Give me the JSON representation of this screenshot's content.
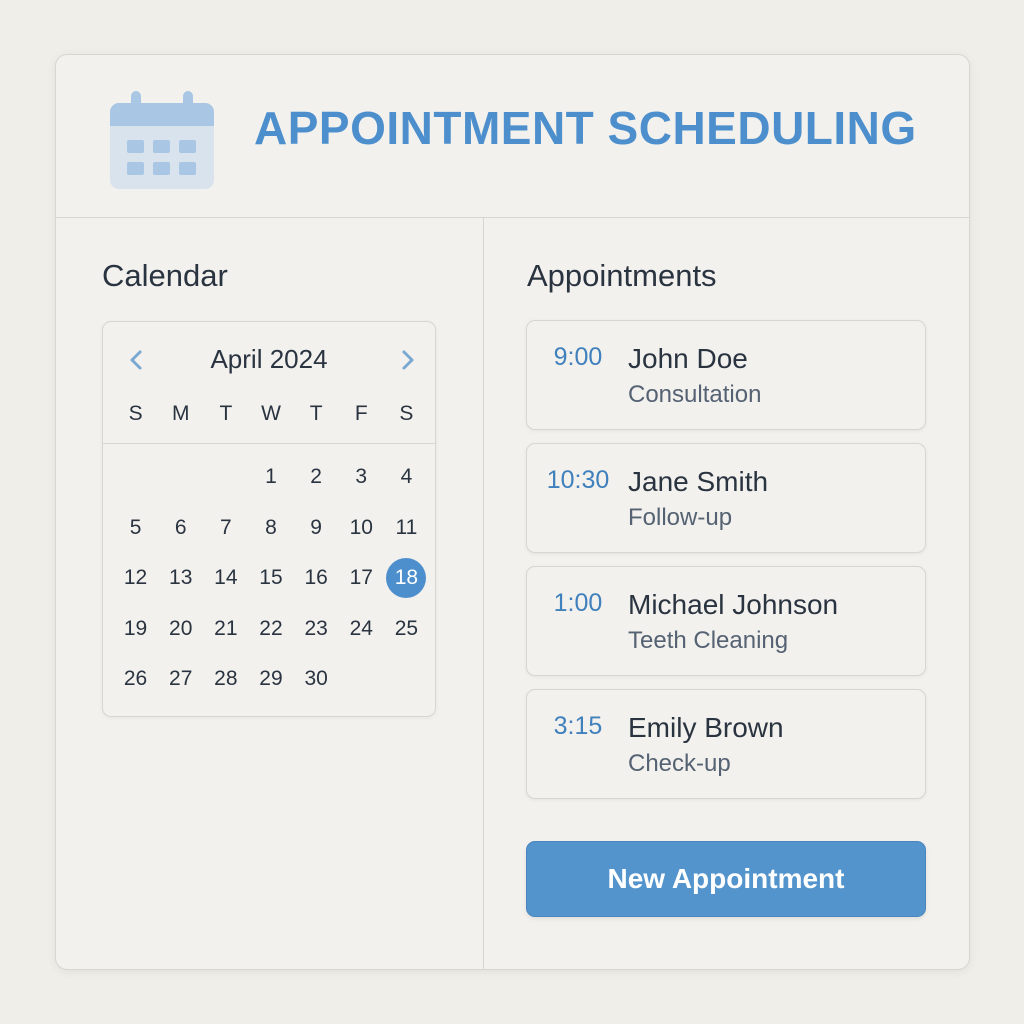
{
  "header": {
    "title": "APPOINTMENT SCHEDULING",
    "icon": "calendar-icon"
  },
  "calendar": {
    "section_title": "Calendar",
    "month_label": "April 2024",
    "prev_icon": "chevron-left-icon",
    "next_icon": "chevron-right-icon",
    "weekdays": [
      "S",
      "M",
      "T",
      "W",
      "T",
      "F",
      "S"
    ],
    "leading_blank_days": 3,
    "days": [
      "1",
      "2",
      "3",
      "4",
      "5",
      "6",
      "7",
      "8",
      "9",
      "10",
      "11",
      "12",
      "13",
      "14",
      "15",
      "16",
      "17",
      "18",
      "19",
      "20",
      "21",
      "22",
      "23",
      "24",
      "25",
      "26",
      "27",
      "28",
      "29",
      "30"
    ],
    "selected_day": "18"
  },
  "appointments": {
    "section_title": "Appointments",
    "items": [
      {
        "time": "9:00",
        "name": "John Doe",
        "type": "Consultation"
      },
      {
        "time": "10:30",
        "name": "Jane Smith",
        "type": "Follow-up"
      },
      {
        "time": "1:00",
        "name": "Michael Johnson",
        "type": "Teeth Cleaning"
      },
      {
        "time": "3:15",
        "name": "Emily Brown",
        "type": "Check-up"
      }
    ]
  },
  "actions": {
    "new_appointment_label": "New Appointment"
  },
  "colors": {
    "accent": "#4d8fcc",
    "button": "#5394cd",
    "background": "#efeee9",
    "card": "#f2f1ed"
  }
}
